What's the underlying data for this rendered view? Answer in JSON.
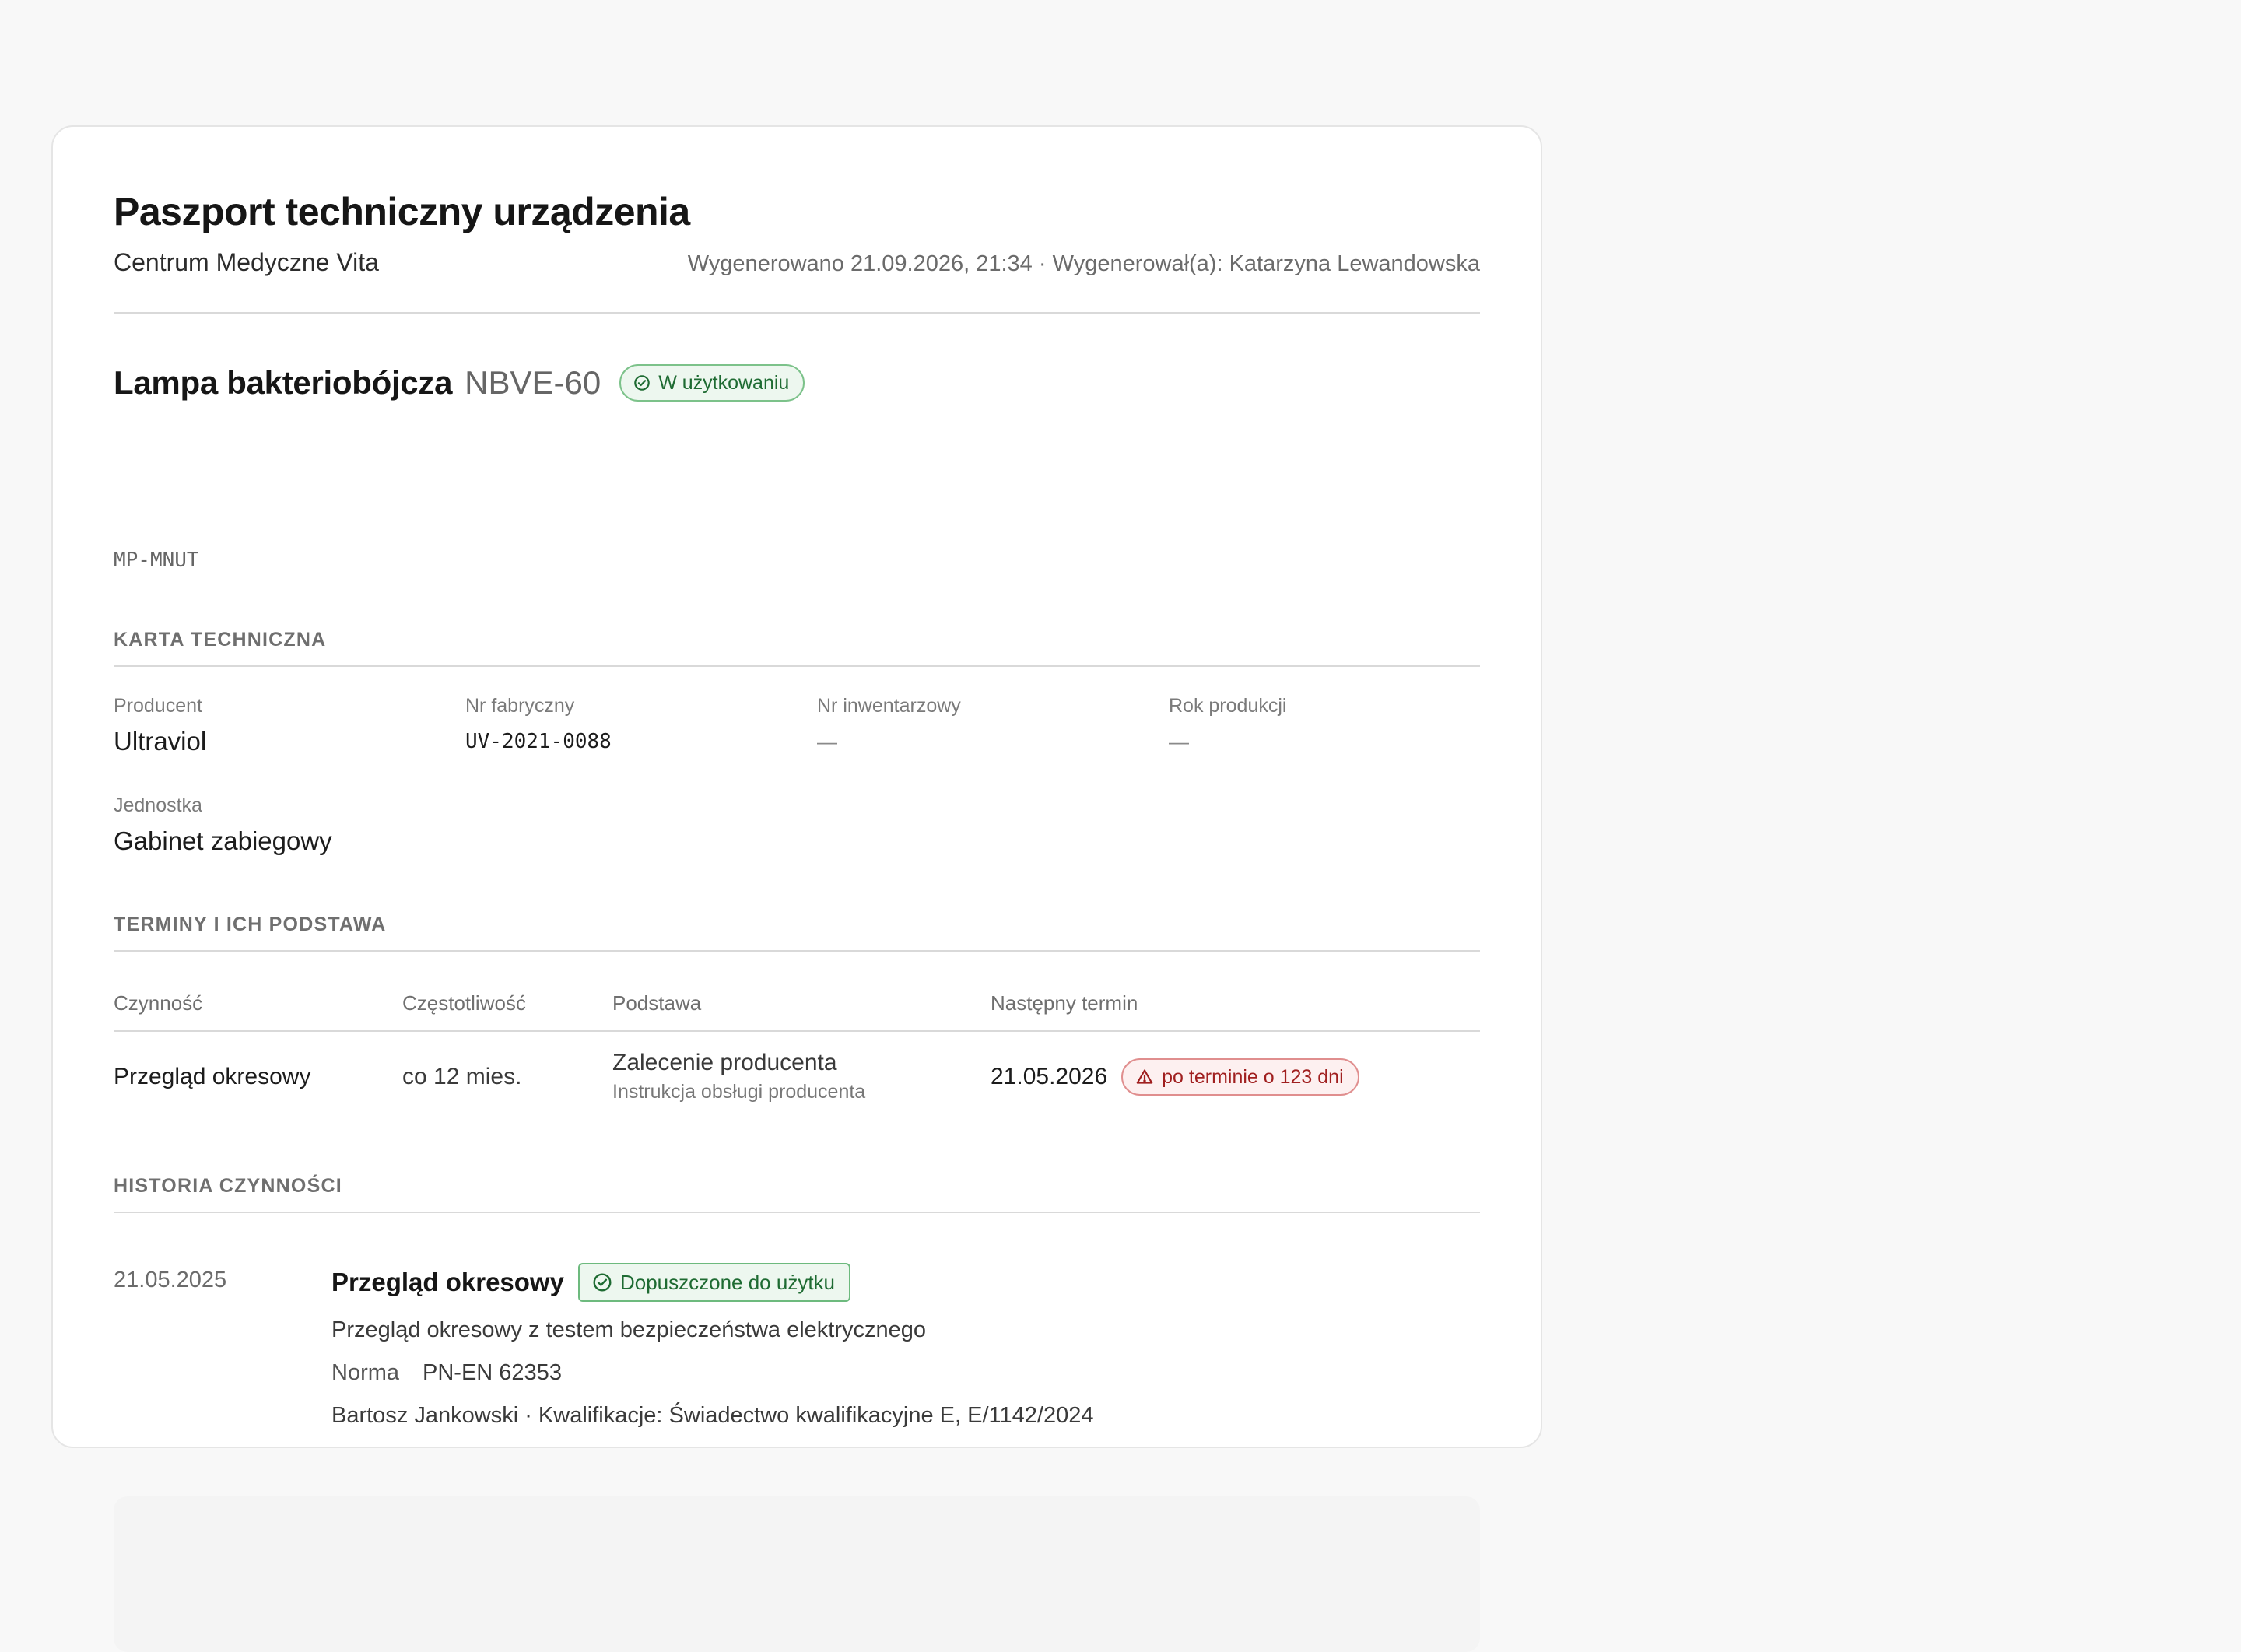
{
  "header": {
    "title": "Paszport techniczny urządzenia",
    "organization": "Centrum Medyczne Vita",
    "generated": "Wygenerowano 21.09.2026, 21:34 · Wygenerował(a): Katarzyna Lewandowska"
  },
  "device": {
    "name": "Lampa bakteriobójcza",
    "model": "NBVE-60",
    "status": "W użytkowaniu",
    "code": "MP-MNUT"
  },
  "tech_card": {
    "section_title": "KARTA TECHNICZNA",
    "fields": [
      {
        "label": "Producent",
        "value": "Ultraviol"
      },
      {
        "label": "Nr fabryczny",
        "value": "UV-2021-0088"
      },
      {
        "label": "Nr inwentarzowy",
        "value": "—"
      },
      {
        "label": "Rok produkcji",
        "value": "—"
      },
      {
        "label": "Jednostka",
        "value": "Gabinet zabiegowy"
      }
    ]
  },
  "schedule": {
    "section_title": "TERMINY I ICH PODSTAWA",
    "columns": [
      "Czynność",
      "Częstotliwość",
      "Podstawa",
      "Następny termin"
    ],
    "rows": [
      {
        "activity": "Przegląd okresowy",
        "frequency": "co 12 mies.",
        "basis": "Zalecenie producenta",
        "basis_detail": "Instrukcja obsługi producenta",
        "next_date": "21.05.2026",
        "overdue": "po terminie o 123 dni"
      }
    ]
  },
  "history": {
    "section_title": "HISTORIA CZYNNOŚCI",
    "entries": [
      {
        "date": "21.05.2025",
        "title": "Przegląd okresowy",
        "result": "Dopuszczone do użytku",
        "description": "Przegląd okresowy z testem bezpieczeństwa elektrycznego",
        "norm_label": "Norma",
        "norm_value": "PN-EN 62353",
        "performer": "Bartosz Jankowski · Kwalifikacje: Świadectwo kwalifikacyjne E, E/1142/2024"
      }
    ]
  },
  "colors": {
    "accent_green": "#1e6b32",
    "alert_red": "#a01f1f"
  }
}
